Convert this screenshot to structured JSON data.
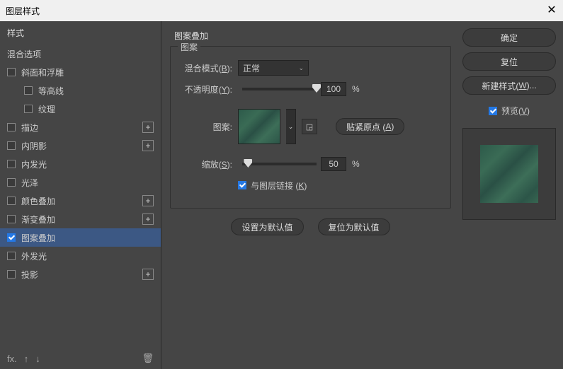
{
  "title": "图层样式",
  "sidebar": {
    "header": "样式",
    "blend_opts": "混合选项",
    "items": [
      {
        "label": "斜面和浮雕",
        "checked": false,
        "plus": false,
        "indent": 0
      },
      {
        "label": "等高线",
        "checked": false,
        "plus": false,
        "indent": 1
      },
      {
        "label": "纹理",
        "checked": false,
        "plus": false,
        "indent": 1
      },
      {
        "label": "描边",
        "checked": false,
        "plus": true,
        "indent": 0
      },
      {
        "label": "内阴影",
        "checked": false,
        "plus": true,
        "indent": 0
      },
      {
        "label": "内发光",
        "checked": false,
        "plus": false,
        "indent": 0
      },
      {
        "label": "光泽",
        "checked": false,
        "plus": false,
        "indent": 0
      },
      {
        "label": "颜色叠加",
        "checked": false,
        "plus": true,
        "indent": 0
      },
      {
        "label": "渐变叠加",
        "checked": false,
        "plus": true,
        "indent": 0
      },
      {
        "label": "图案叠加",
        "checked": true,
        "plus": false,
        "indent": 0,
        "selected": true
      },
      {
        "label": "外发光",
        "checked": false,
        "plus": false,
        "indent": 0
      },
      {
        "label": "投影",
        "checked": false,
        "plus": true,
        "indent": 0
      }
    ]
  },
  "panel": {
    "title": "图案叠加",
    "group": "图案",
    "blend_mode_label": "混合模式(B):",
    "blend_mode_value": "正常",
    "opacity_label": "不透明度(Y):",
    "opacity_value": "100",
    "pattern_label": "图案:",
    "snap_btn": "贴紧原点 (A)",
    "scale_label": "缩放(S):",
    "scale_value": "50",
    "percent": "%",
    "link_label": "与图层链接 (K)",
    "set_default": "设置为默认值",
    "reset_default": "复位为默认值"
  },
  "right": {
    "ok": "确定",
    "reset": "复位",
    "new_style": "新建样式(W)...",
    "preview": "预览(V)"
  }
}
